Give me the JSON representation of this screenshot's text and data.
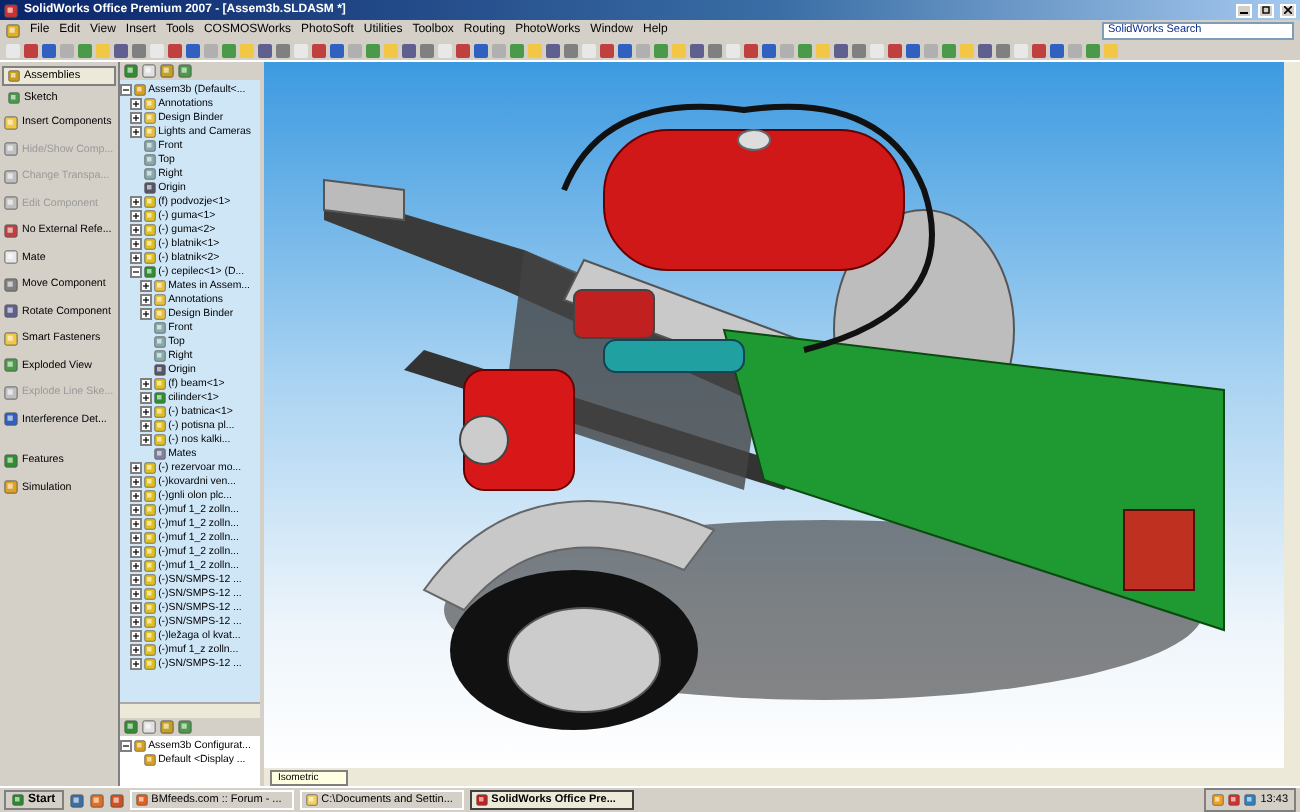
{
  "window": {
    "title": "SolidWorks Office Premium 2007 - [Assem3b.SLDASM *]"
  },
  "menu": [
    "File",
    "Edit",
    "View",
    "Insert",
    "Tools",
    "COSMOSWorks",
    "PhotoSoft",
    "Utilities",
    "Toolbox",
    "Routing",
    "PhotoWorks",
    "Window",
    "Help"
  ],
  "search": {
    "placeholder": "SolidWorks Search"
  },
  "command_manager": {
    "tabs": [
      {
        "label": "Assemblies",
        "selected": true
      },
      {
        "label": "Sketch",
        "selected": false
      }
    ],
    "tools": [
      {
        "label": "Insert Components",
        "disabled": false
      },
      {
        "label": "Hide/Show Comp...",
        "disabled": true
      },
      {
        "label": "Change Transpa...",
        "disabled": true
      },
      {
        "label": "Edit Component",
        "disabled": true
      },
      {
        "label": "No External Refe...",
        "disabled": false
      },
      {
        "label": "Mate",
        "disabled": false
      },
      {
        "label": "Move Component",
        "disabled": false
      },
      {
        "label": "Rotate Component",
        "disabled": false
      },
      {
        "label": "Smart Fasteners",
        "disabled": false
      },
      {
        "label": "Exploded View",
        "disabled": false
      },
      {
        "label": "Explode Line Ske...",
        "disabled": true
      },
      {
        "label": "Interference Det...",
        "disabled": false
      }
    ],
    "groups": [
      "Features",
      "Simulation"
    ]
  },
  "feature_tree": [
    {
      "label": "Assem3b (Default<...",
      "kind": "assembly",
      "expanded": true,
      "children": [
        {
          "label": "Annotations",
          "kind": "folder",
          "expanded": false
        },
        {
          "label": "Design Binder",
          "kind": "folder",
          "expanded": false
        },
        {
          "label": "Lights and Cameras",
          "kind": "folder",
          "expanded": false
        },
        {
          "label": "Front",
          "kind": "plane"
        },
        {
          "label": "Top",
          "kind": "plane"
        },
        {
          "label": "Right",
          "kind": "plane"
        },
        {
          "label": "Origin",
          "kind": "origin"
        },
        {
          "label": "(f) podvozje<1>",
          "kind": "part",
          "expanded": false
        },
        {
          "label": "(-) guma<1>",
          "kind": "part",
          "expanded": false
        },
        {
          "label": "(-) guma<2>",
          "kind": "part",
          "expanded": false
        },
        {
          "label": "(-) blatnik<1>",
          "kind": "part",
          "expanded": false
        },
        {
          "label": "(-) blatnik<2>",
          "kind": "part",
          "expanded": false
        },
        {
          "label": "(-) cepilec<1> (D...",
          "kind": "subassembly",
          "expanded": true,
          "children": [
            {
              "label": "Mates in Assem...",
              "kind": "folder",
              "expanded": false
            },
            {
              "label": "Annotations",
              "kind": "folder",
              "expanded": false
            },
            {
              "label": "Design Binder",
              "kind": "folder",
              "expanded": false
            },
            {
              "label": "Front",
              "kind": "plane"
            },
            {
              "label": "Top",
              "kind": "plane"
            },
            {
              "label": "Right",
              "kind": "plane"
            },
            {
              "label": "Origin",
              "kind": "origin"
            },
            {
              "label": "(f) beam<1>",
              "kind": "part",
              "expanded": false
            },
            {
              "label": "cilinder<1>",
              "kind": "subassembly",
              "expanded": false
            },
            {
              "label": "(-) batnica<1>",
              "kind": "part",
              "expanded": false
            },
            {
              "label": "(-) potisna pl...",
              "kind": "part",
              "expanded": false
            },
            {
              "label": "(-) nos kalki...",
              "kind": "part",
              "expanded": false
            },
            {
              "label": "Mates",
              "kind": "mates"
            }
          ]
        },
        {
          "label": "(-) rezervoar mo...",
          "kind": "part",
          "expanded": false
        },
        {
          "label": "(-)kovardni ven...",
          "kind": "part",
          "expanded": false
        },
        {
          "label": "(-)gnli olon plc...",
          "kind": "part",
          "expanded": false
        },
        {
          "label": "(-)muf 1_2 zolln...",
          "kind": "part",
          "expanded": false
        },
        {
          "label": "(-)muf 1_2 zolln...",
          "kind": "part",
          "expanded": false
        },
        {
          "label": "(-)muf 1_2 zolln...",
          "kind": "part",
          "expanded": false
        },
        {
          "label": "(-)muf 1_2 zolln...",
          "kind": "part",
          "expanded": false
        },
        {
          "label": "(-)muf 1_2 zolln...",
          "kind": "part",
          "expanded": false
        },
        {
          "label": "(-)SN/SMPS-12 ...",
          "kind": "part",
          "expanded": false
        },
        {
          "label": "(-)SN/SMPS-12 ...",
          "kind": "part",
          "expanded": false
        },
        {
          "label": "(-)SN/SMPS-12 ...",
          "kind": "part",
          "expanded": false
        },
        {
          "label": "(-)SN/SMPS-12 ...",
          "kind": "part",
          "expanded": false
        },
        {
          "label": "(-)ležaga ol kvat...",
          "kind": "part",
          "expanded": false
        },
        {
          "label": "(-)muf 1_z zolln...",
          "kind": "part",
          "expanded": false
        },
        {
          "label": "(-)SN/SMPS-12 ...",
          "kind": "part",
          "expanded": false
        }
      ]
    }
  ],
  "configuration_tree": [
    {
      "label": "Assem3b Configurat...",
      "kind": "assembly",
      "expanded": true,
      "children": [
        {
          "label": "Default <Display ...",
          "kind": "config"
        }
      ]
    }
  ],
  "view_orientation": "Isometric",
  "taskbar": {
    "start": "Start",
    "tasks": [
      {
        "label": "BMfeeds.com :: Forum - ...",
        "selected": false
      },
      {
        "label": "C:\\Documents and Settin...",
        "selected": false
      },
      {
        "label": "SolidWorks Office Pre...",
        "selected": true
      }
    ],
    "clock": "13:43"
  }
}
